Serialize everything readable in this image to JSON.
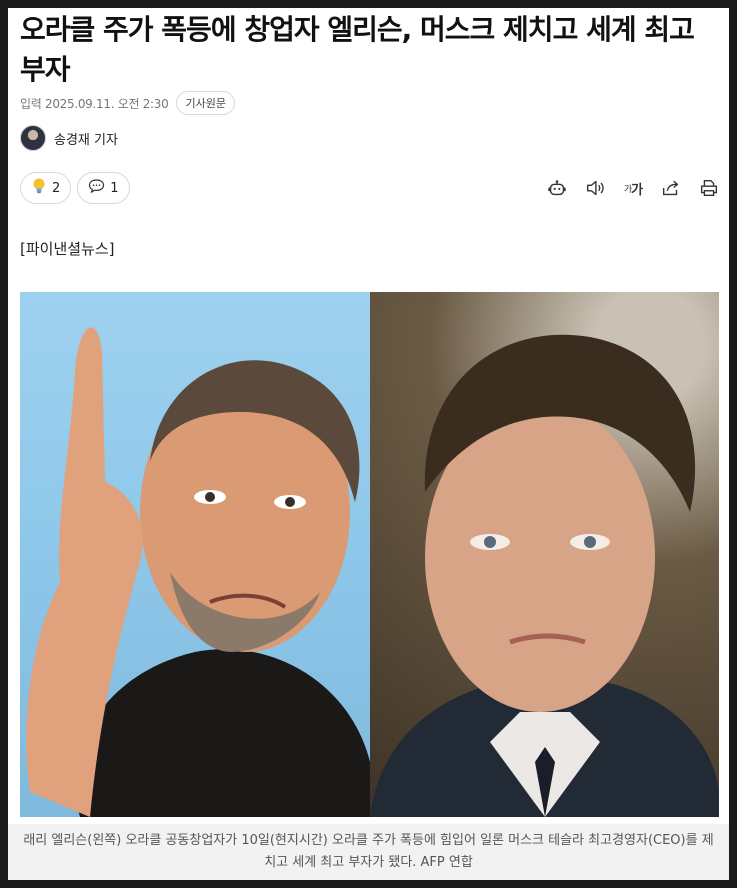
{
  "article": {
    "title": "오라클 주가 폭등에 창업자 엘리슨, 머스크 제치고 세계 최고 부자",
    "published_label": "입력 2025.09.11. 오전 2:30",
    "source_chip": "기사원문",
    "author": "송경재 기자",
    "press_tag": "[파이낸셜뉴스]"
  },
  "reactions": {
    "like_icon": "lightbulb-icon",
    "like_count": "2",
    "comment_icon": "speech-bubble-icon",
    "comment_count": "1"
  },
  "toolbar": {
    "tools": [
      "robot-summary-icon",
      "speaker-icon",
      "font-size-icon",
      "share-icon",
      "print-icon"
    ],
    "font_size_label_small": "가",
    "font_size_label_large": "가"
  },
  "photo": {
    "caption": "래리 엘리슨(왼쪽) 오라클 공동창업자가 10일(현지시간) 오라클 주가 폭등에 힘입어 일론 머스크 테슬라 최고경영자(CEO)를 제치고 세계 최고 부자가 됐다. AFP 연합"
  },
  "colors": {
    "window_frame": "#1a1a1a",
    "page_bg": "#ffffff",
    "caption_bg": "#f2f2f2",
    "left_photo_bg": "#8fc8ea",
    "right_photo_bg": "#4a3c2c"
  }
}
